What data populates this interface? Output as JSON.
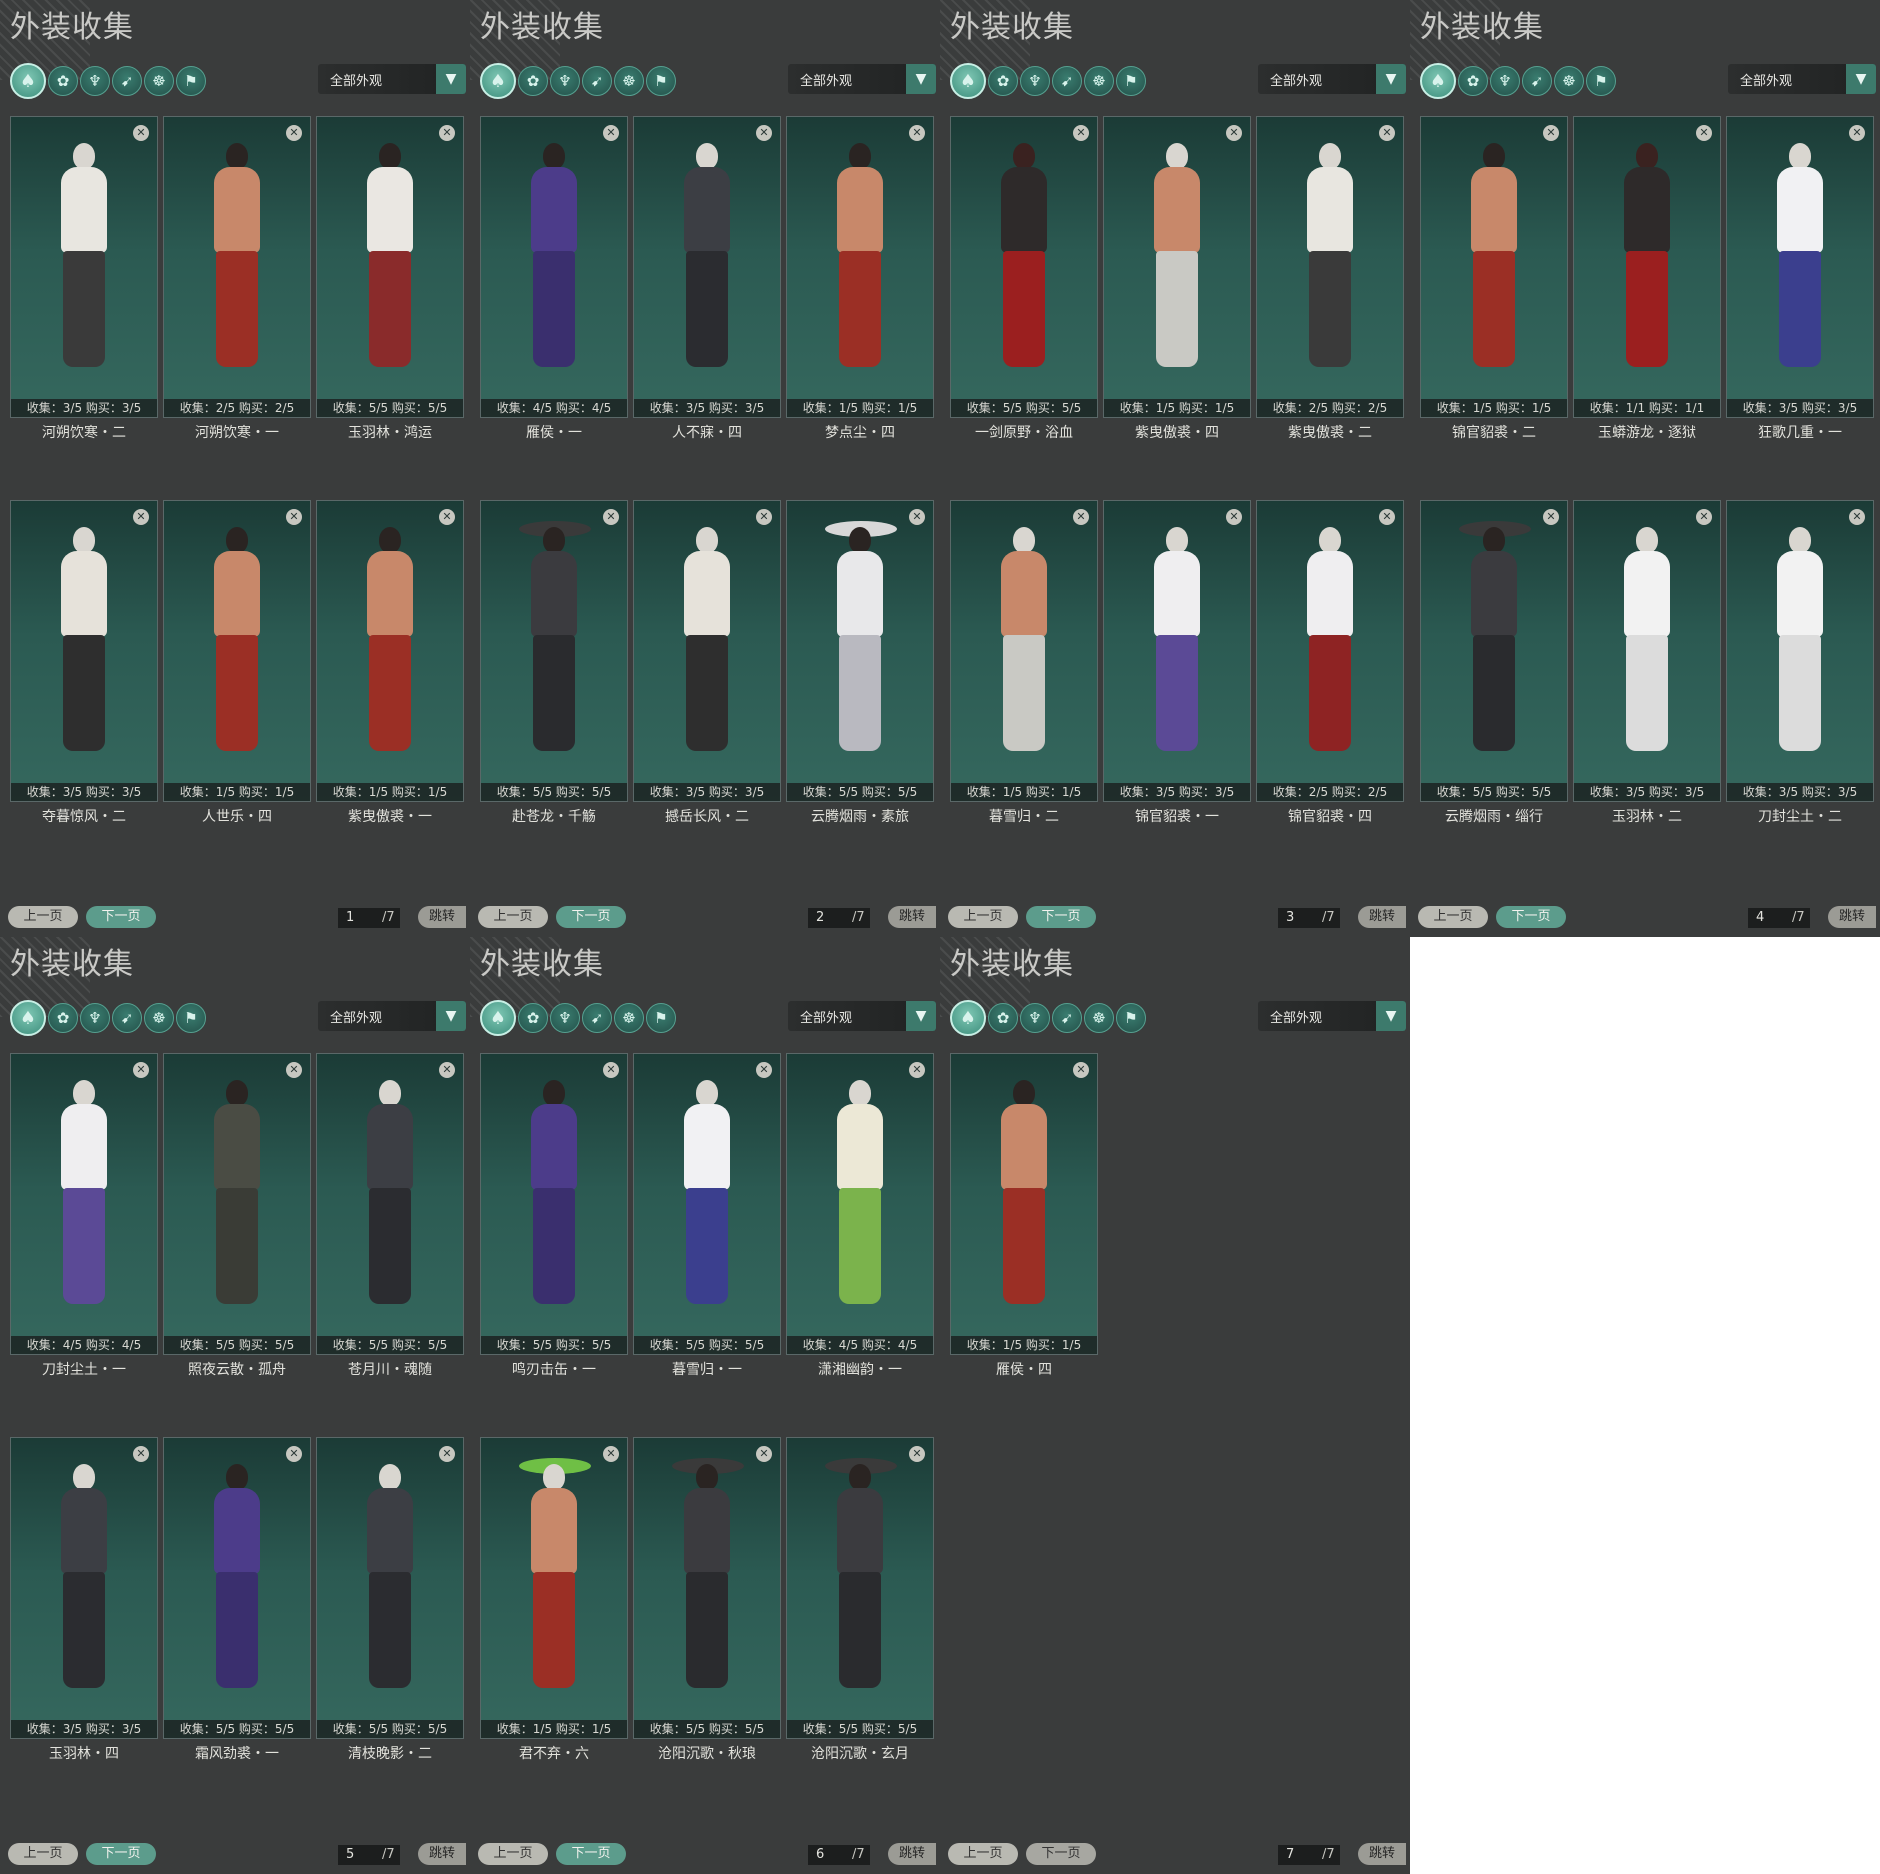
{
  "panel_title": "外装收集",
  "filter_label": "全部外观",
  "prev_label": "上一页",
  "next_label": "下一页",
  "jump_label": "跳转",
  "total_pages": "/7",
  "filter_icons": [
    "outfit-icon",
    "hair-icon",
    "shoulder-icon",
    "weapon-icon",
    "mount-icon",
    "pendant-icon"
  ],
  "pages": [
    {
      "page": "1",
      "items": [
        {
          "stats": "收集：3/5  购买：3/5",
          "name": "河朔饮寒・二",
          "look": "whitefur"
        },
        {
          "stats": "收集：2/5  购买：2/5",
          "name": "河朔饮寒・一",
          "look": "redpants"
        },
        {
          "stats": "收集：5/5  购买：5/5",
          "name": "玉羽林・鸿运",
          "look": "whitered"
        },
        {
          "stats": "收集：3/5  购买：3/5",
          "name": "夺暮惊风・二",
          "look": "whiteblack"
        },
        {
          "stats": "收集：1/5  购买：1/5",
          "name": "人世乐・四",
          "look": "redpants"
        },
        {
          "stats": "收集：1/5  购买：1/5",
          "name": "紫曳傲裘・一",
          "look": "redpants"
        }
      ]
    },
    {
      "page": "2",
      "items": [
        {
          "stats": "收集：4/5  购买：4/5",
          "name": "雁侯・一",
          "look": "purple"
        },
        {
          "stats": "收集：3/5  购买：3/5",
          "name": "人不寐・四",
          "look": "dark"
        },
        {
          "stats": "收集：1/5  购买：1/5",
          "name": "梦点尘・四",
          "look": "redpants"
        },
        {
          "stats": "收集：5/5  购买：5/5",
          "name": "赴苍龙・千觞",
          "look": "hatdark"
        },
        {
          "stats": "收集：3/5  购买：3/5",
          "name": "撼岳长风・二",
          "look": "whiteblack"
        },
        {
          "stats": "收集：5/5  购买：5/5",
          "name": "云腾烟雨・素旅",
          "look": "hatwhite"
        }
      ]
    },
    {
      "page": "3",
      "items": [
        {
          "stats": "收集：5/5  购买：5/5",
          "name": "一剑原野・浴血",
          "look": "redblack"
        },
        {
          "stats": "收集：1/5  购买：1/5",
          "name": "紫曳傲裘・四",
          "look": "whitepants"
        },
        {
          "stats": "收集：2/5  购买：2/5",
          "name": "紫曳傲裘・二",
          "look": "whitefur"
        },
        {
          "stats": "收集：1/5  购买：1/5",
          "name": "暮雪归・二",
          "look": "whitepants"
        },
        {
          "stats": "收集：3/5  购买：3/5",
          "name": "锦官貂裘・一",
          "look": "purplewhite"
        },
        {
          "stats": "收集：2/5  购买：2/5",
          "name": "锦官貂裘・四",
          "look": "redwhite"
        }
      ]
    },
    {
      "page": "4",
      "items": [
        {
          "stats": "收集：1/5  购买：1/5",
          "name": "锦官貂裘・二",
          "look": "redpants"
        },
        {
          "stats": "收集：1/1  购买：1/1",
          "name": "玉蟒游龙・逐狱",
          "look": "redblack"
        },
        {
          "stats": "收集：3/5  购买：3/5",
          "name": "狂歌几重・一",
          "look": "bluewhite"
        },
        {
          "stats": "收集：5/5  购买：5/5",
          "name": "云腾烟雨・缁行",
          "look": "hatdark"
        },
        {
          "stats": "收集：3/5  购买：3/5",
          "name": "玉羽林・二",
          "look": "white"
        },
        {
          "stats": "收集：3/5  购买：3/5",
          "name": "刀封尘土・二",
          "look": "white"
        }
      ]
    },
    {
      "page": "5",
      "items": [
        {
          "stats": "收集：4/5  购买：4/5",
          "name": "刀封尘土・一",
          "look": "purplewhite"
        },
        {
          "stats": "收集：5/5  购买：5/5",
          "name": "照夜云散・孤舟",
          "look": "olive"
        },
        {
          "stats": "收集：5/5  购买：5/5",
          "name": "苍月川・魂随",
          "look": "dark"
        },
        {
          "stats": "收集：3/5  购买：3/5",
          "name": "玉羽林・四",
          "look": "dark"
        },
        {
          "stats": "收集：5/5  购买：5/5",
          "name": "霜风劲裘・一",
          "look": "purple"
        },
        {
          "stats": "收集：5/5  购买：5/5",
          "name": "清枝晚影・二",
          "look": "dark"
        }
      ]
    },
    {
      "page": "6",
      "items": [
        {
          "stats": "收集：5/5  购买：5/5",
          "name": "鸣刃击缶・一",
          "look": "purple"
        },
        {
          "stats": "收集：5/5  购买：5/5",
          "name": "暮雪归・一",
          "look": "bluewhite"
        },
        {
          "stats": "收集：4/5  购买：4/5",
          "name": "潇湘幽韵・一",
          "look": "green"
        },
        {
          "stats": "收集：1/5  购买：1/5",
          "name": "君不弃・六",
          "look": "greenhat"
        },
        {
          "stats": "收集：5/5  购买：5/5",
          "name": "沧阳沉歌・秋琅",
          "look": "hatdark"
        },
        {
          "stats": "收集：5/5  购买：5/5",
          "name": "沧阳沉歌・玄月",
          "look": "hatdark"
        }
      ]
    },
    {
      "page": "7",
      "items": [
        {
          "stats": "收集：1/5  购买：1/5",
          "name": "雁侯・四",
          "look": "redpants"
        }
      ]
    }
  ]
}
